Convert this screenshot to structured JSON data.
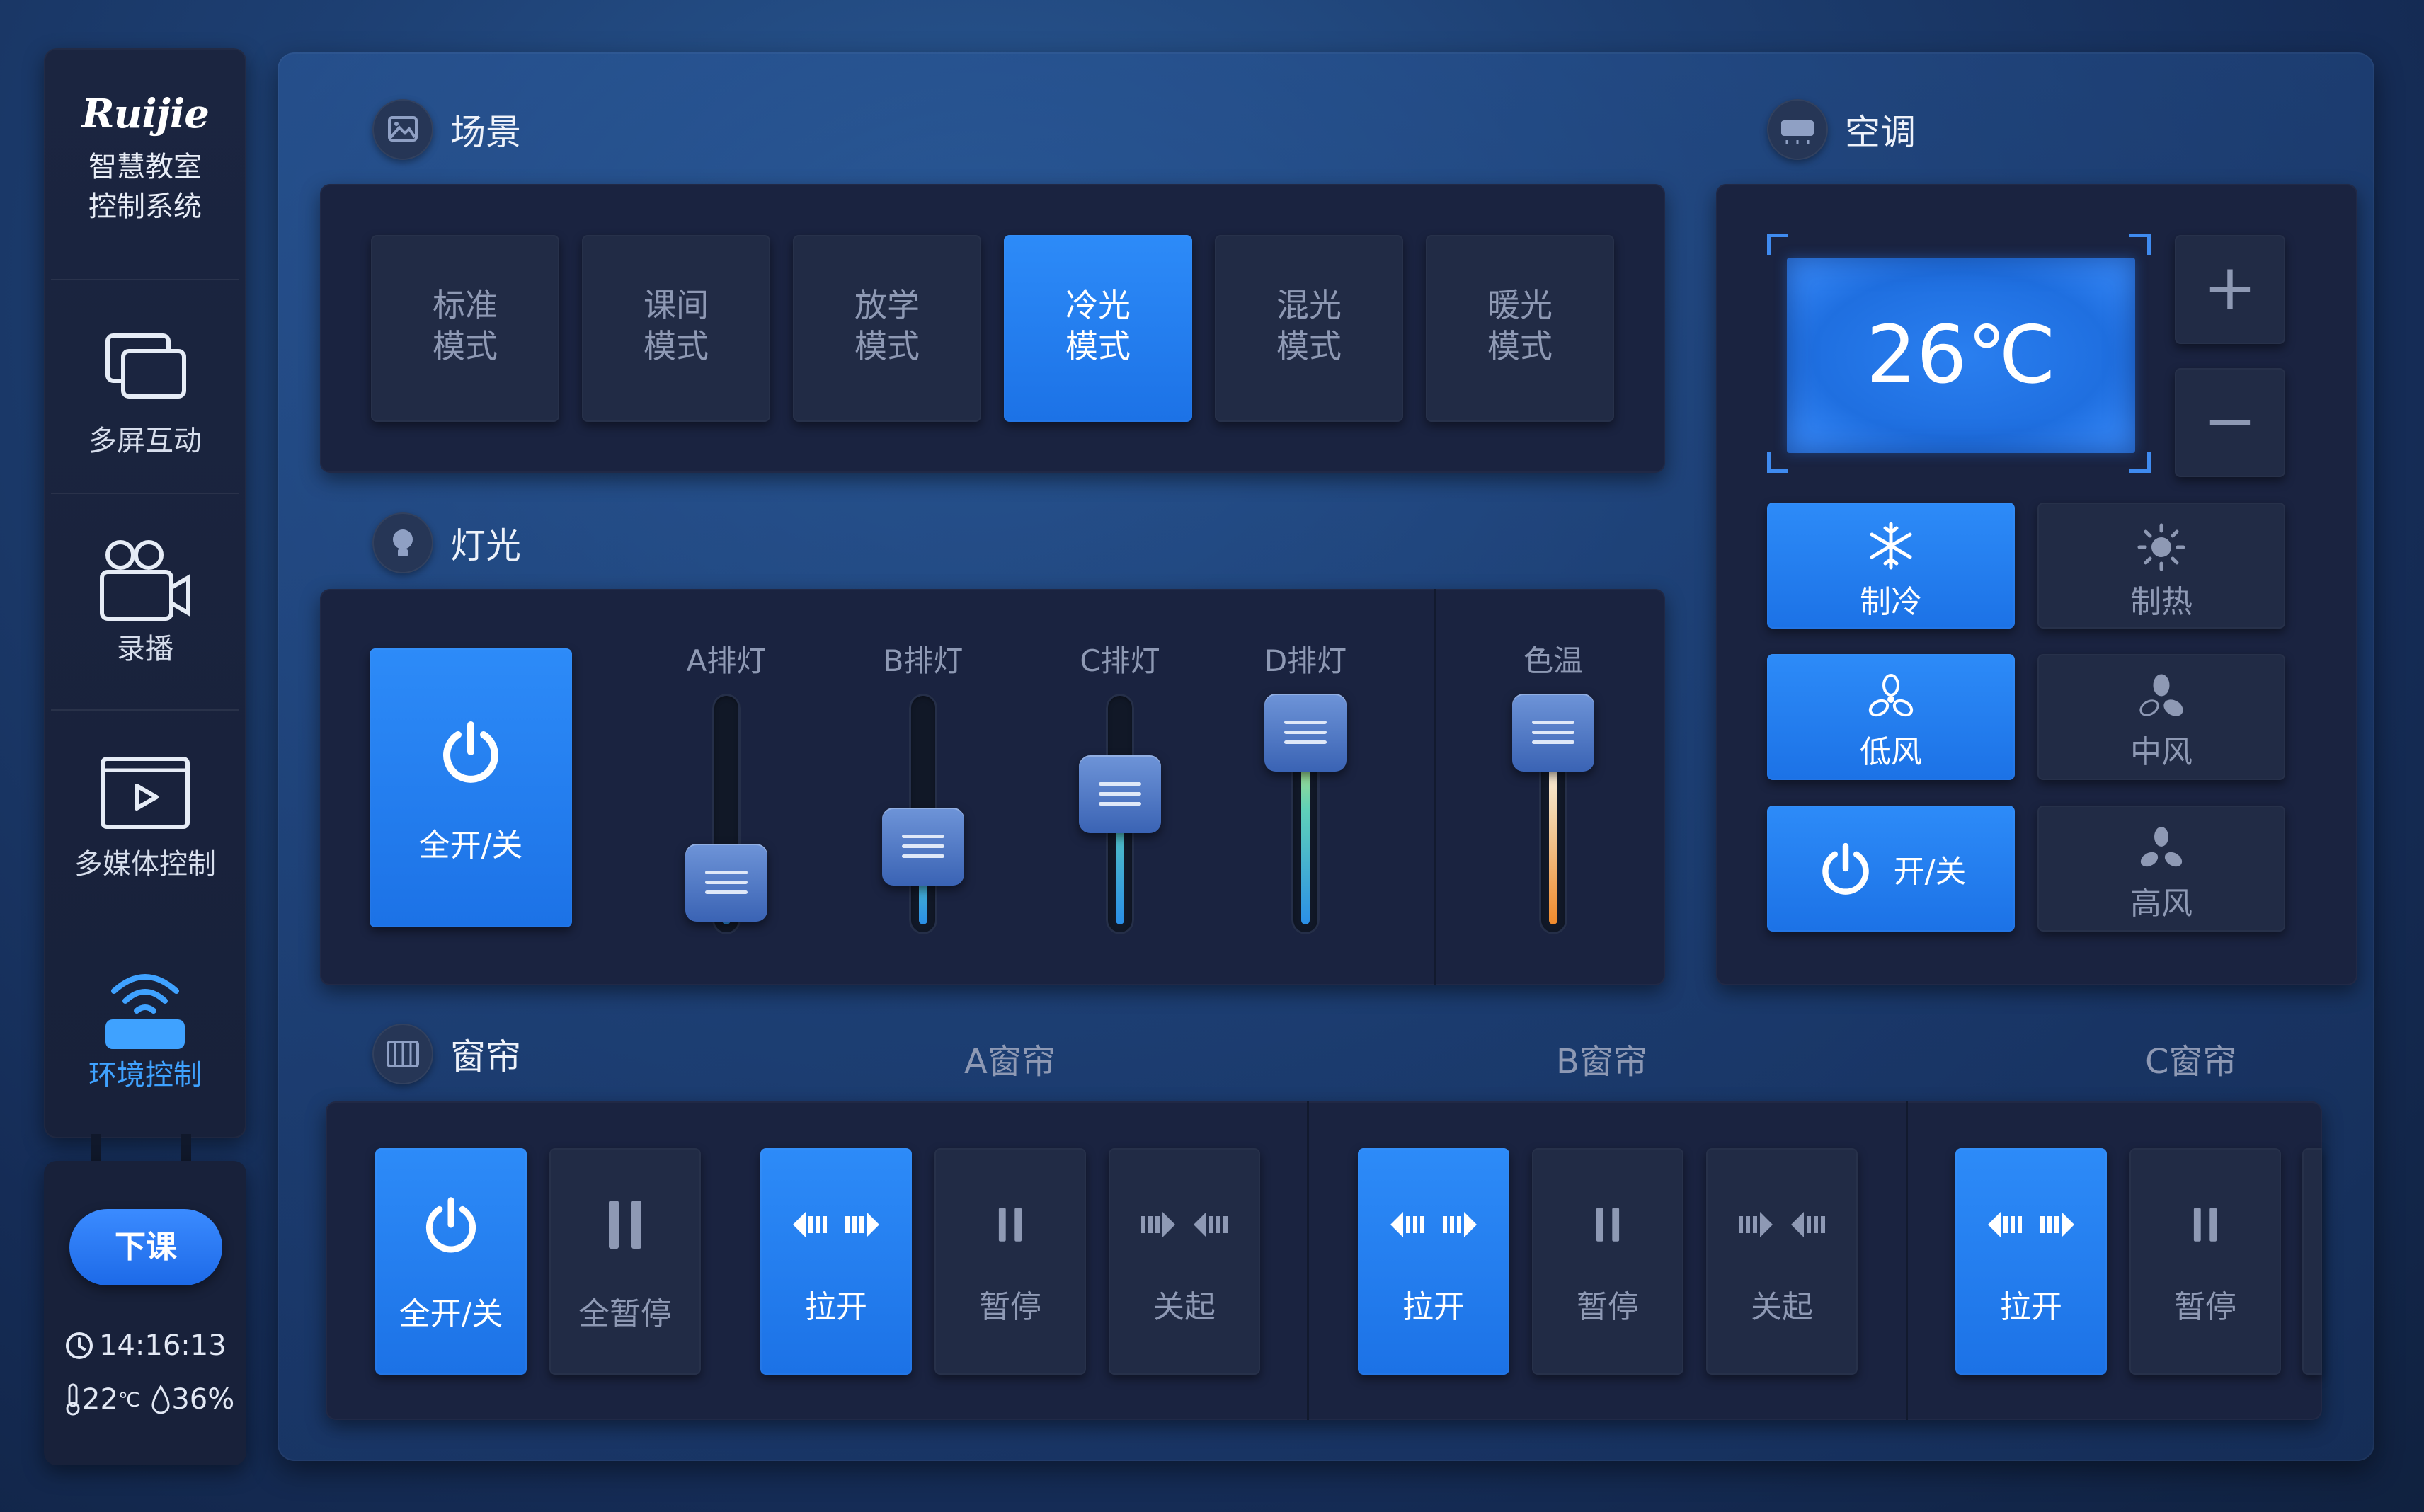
{
  "brand": {
    "logo": "Ruijie",
    "line1": "智慧教室",
    "line2": "控制系统"
  },
  "nav": [
    {
      "label": "多屏互动",
      "icon": "multi-screen-icon",
      "active": false
    },
    {
      "label": "录播",
      "icon": "video-camera-icon",
      "active": false
    },
    {
      "label": "多媒体控制",
      "icon": "media-player-icon",
      "active": false
    },
    {
      "label": "环境控制",
      "icon": "wifi-router-icon",
      "active": true
    }
  ],
  "footer": {
    "dismiss": "下课",
    "time": "14:16:13",
    "temperature": "22",
    "temperature_unit": "℃",
    "humidity": "36%"
  },
  "scene": {
    "title": "场景",
    "modes": [
      {
        "line1": "标准",
        "line2": "模式",
        "active": false
      },
      {
        "line1": "课间",
        "line2": "模式",
        "active": false
      },
      {
        "line1": "放学",
        "line2": "模式",
        "active": false
      },
      {
        "line1": "冷光",
        "line2": "模式",
        "active": true
      },
      {
        "line1": "混光",
        "line2": "模式",
        "active": false
      },
      {
        "line1": "暖光",
        "line2": "模式",
        "active": false
      }
    ]
  },
  "light": {
    "title": "灯光",
    "master": "全开/关",
    "sliders": [
      {
        "label": "A排灯",
        "level": 0.08
      },
      {
        "label": "B排灯",
        "level": 0.3
      },
      {
        "label": "C排灯",
        "level": 0.62
      },
      {
        "label": "D排灯",
        "level": 1.0
      }
    ],
    "color_temp": {
      "label": "色温",
      "level": 1.0
    }
  },
  "ac": {
    "title": "空调",
    "temperature": "26℃",
    "plus": "+",
    "minus": "−",
    "modes": [
      {
        "label": "制冷",
        "icon": "snowflake-icon",
        "active": true
      },
      {
        "label": "制热",
        "icon": "sun-icon",
        "active": false
      },
      {
        "label": "低风",
        "icon": "fan-icon",
        "active": true
      },
      {
        "label": "中风",
        "icon": "fan-icon",
        "active": false
      },
      {
        "label": "开/关",
        "icon": "power-icon",
        "active": true
      },
      {
        "label": "高风",
        "icon": "fan-icon",
        "active": false
      }
    ]
  },
  "curtain": {
    "title": "窗帘",
    "master_on": "全开/关",
    "master_pause": "全暂停",
    "groups": [
      {
        "name": "A窗帘",
        "open": "拉开",
        "pause": "暂停",
        "close": "关起"
      },
      {
        "name": "B窗帘",
        "open": "拉开",
        "pause": "暂停",
        "close": "关起"
      },
      {
        "name": "C窗帘",
        "open": "拉开",
        "pause": "暂停"
      }
    ]
  },
  "colors": {
    "accent": "#2a86f5",
    "tile": "#212b45",
    "panel": "#1a2340",
    "active_nav_text": "#3fa2ff"
  }
}
